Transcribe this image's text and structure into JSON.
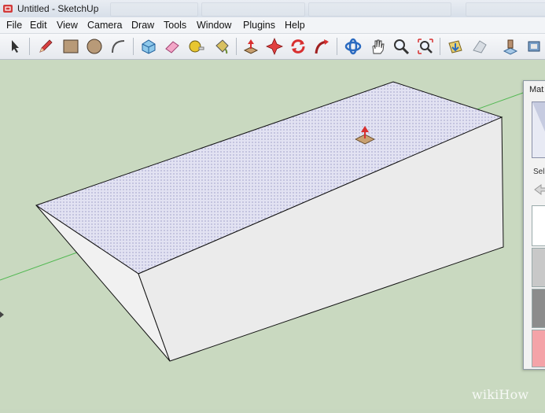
{
  "window": {
    "title": "Untitled - SketchUp"
  },
  "menu": {
    "items": [
      "File",
      "Edit",
      "View",
      "Camera",
      "Draw",
      "Tools",
      "Window",
      "Plugins",
      "Help"
    ]
  },
  "toolbar": {
    "tools": [
      "select-icon",
      "pencil-icon",
      "rectangle-icon",
      "circle-icon",
      "arc-icon",
      "make-component-icon",
      "eraser-icon",
      "tape-measure-icon",
      "paint-bucket-icon",
      "push-pull-icon",
      "move-icon",
      "rotate-icon",
      "follow-me-icon",
      "orbit-icon",
      "pan-icon",
      "zoom-icon",
      "zoom-extents-icon",
      "get-models-icon",
      "share-model-icon",
      "3d-warehouse-icon"
    ]
  },
  "materials_panel": {
    "title": "Mat",
    "select_label": "Sel",
    "swatch_colors": [
      "#ffffff",
      "#c8c8c8",
      "#8c8c8c",
      "#f4a3a8"
    ]
  },
  "watermark": "wikiHow",
  "colors": {
    "viewport_bg": "#c9d9c0",
    "top_face": "#dcdcf0",
    "side_face": "#ececec",
    "axis_green": "#52b852"
  }
}
